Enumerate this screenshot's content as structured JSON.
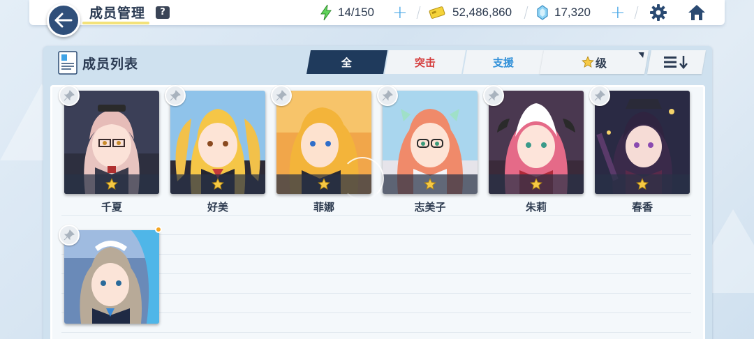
{
  "header": {
    "title": "成员管理",
    "help_label": "?"
  },
  "resources": {
    "stamina": "14/150",
    "credits": "52,486,860",
    "gems": "17,320"
  },
  "colors": {
    "navy": "#1f3a5c",
    "strike_red": "#d43b3b",
    "support_blue": "#2f8fd8",
    "star_gold": "#f6c945",
    "new_dot": "#f5a623"
  },
  "panel": {
    "title": "成员列表",
    "tabs": [
      {
        "label": "全",
        "active": true
      },
      {
        "label": "突击",
        "active": false
      },
      {
        "label": "支援",
        "active": false
      }
    ],
    "sort_label": "级",
    "sort_icon": "star-icon",
    "order_icon": "sort-descending-icon"
  },
  "members": [
    {
      "name": "千夏",
      "stars": 1
    },
    {
      "name": "好美",
      "stars": 1
    },
    {
      "name": "菲娜",
      "stars": 1
    },
    {
      "name": "志美子",
      "stars": 1
    },
    {
      "name": "朱莉",
      "stars": 1
    },
    {
      "name": "春香",
      "stars": 1
    },
    {
      "name": "",
      "stars": 0,
      "new": true
    }
  ]
}
